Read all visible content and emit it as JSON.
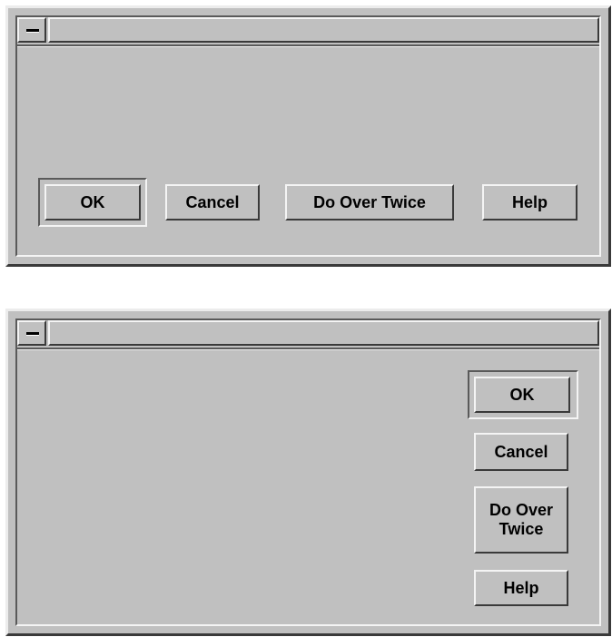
{
  "dialog_horizontal": {
    "buttons": {
      "ok": "OK",
      "cancel": "Cancel",
      "do_over_twice": "Do Over Twice",
      "help": "Help"
    }
  },
  "dialog_vertical": {
    "buttons": {
      "ok": "OK",
      "cancel": "Cancel",
      "do_over_twice": "Do Over\nTwice",
      "help": "Help"
    }
  },
  "icons": {
    "window_menu": "window-menu-icon"
  }
}
